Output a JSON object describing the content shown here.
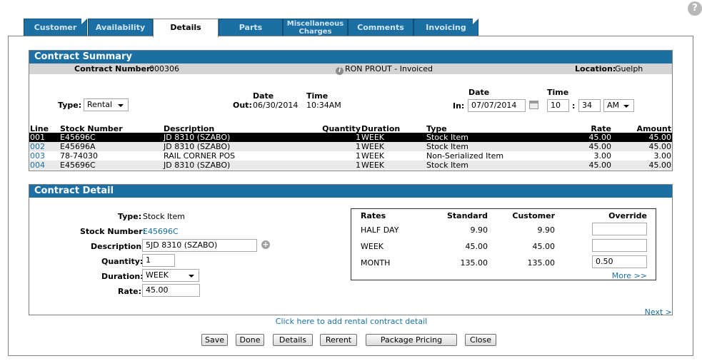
{
  "tabs": [
    {
      "label": "Customer"
    },
    {
      "label": "Availability"
    },
    {
      "label": "Details"
    },
    {
      "label": "Parts"
    },
    {
      "label": "Miscellaneous Charges",
      "line1": "Miscellaneous",
      "line2": "Charges"
    },
    {
      "label": "Comments"
    },
    {
      "label": "Invoicing"
    }
  ],
  "summary": {
    "title": "Contract Summary",
    "contract_label": "Contract Number:",
    "contract_number": "000306",
    "customer_status": "RON PROUT - Invoiced",
    "location_label": "Location:",
    "location": "Guelph",
    "type_label": "Type:",
    "type_value": "Rental",
    "out_label": "Out:",
    "date_header": "Date",
    "time_header": "Time",
    "out_date": "06/30/2014",
    "out_time": "10:34AM",
    "in_label": "In:",
    "in_date": "07/07/2014",
    "in_hour": "10",
    "time_sep": ":",
    "in_minute": "34",
    "in_ampm": "AM"
  },
  "table": {
    "headers": {
      "line": "Line",
      "stock": "Stock Number",
      "desc": "Description",
      "qty": "Quantity",
      "duration": "Duration",
      "type": "Type",
      "rate": "Rate",
      "amount": "Amount"
    },
    "rows": [
      {
        "line": "001",
        "stock": "E45696C",
        "desc": "JD 8310 (SZABO)",
        "qty": "1",
        "duration": "WEEK",
        "type": "Stock Item",
        "rate": "45.00",
        "amount": "45.00"
      },
      {
        "line": "002",
        "stock": "E45696A",
        "desc": "JD 8310 (SZABO)",
        "qty": "1",
        "duration": "WEEK",
        "type": "Stock Item",
        "rate": "45.00",
        "amount": "45.00"
      },
      {
        "line": "003",
        "stock": "78-74030",
        "desc": "RAIL CORNER POS",
        "qty": "1",
        "duration": "WEEK",
        "type": "Non-Serialized Item",
        "rate": "3.00",
        "amount": "3.00"
      },
      {
        "line": "004",
        "stock": "E45696C",
        "desc": "JD 8310 (SZABO)",
        "qty": "1",
        "duration": "WEEK",
        "type": "Stock Item",
        "rate": "45.00",
        "amount": "45.00"
      }
    ]
  },
  "detail": {
    "title": "Contract Detail",
    "type_label": "Type:",
    "type_value": "Stock Item",
    "stock_label": "Stock Number:",
    "stock_value": "E45696C",
    "desc_label": "Description:",
    "desc_value": "5JD 8310 (SZABO)",
    "qty_label": "Quantity:",
    "qty_value": "1",
    "duration_label": "Duration:",
    "duration_value": "WEEK",
    "rate_label": "Rate:",
    "rate_value": "45.00",
    "rates": {
      "headers": {
        "rates": "Rates",
        "standard": "Standard",
        "customer": "Customer",
        "override": "Override"
      },
      "rows": [
        {
          "name": "HALF DAY",
          "standard": "9.90",
          "customer": "9.90",
          "override": ""
        },
        {
          "name": "WEEK",
          "standard": "45.00",
          "customer": "45.00",
          "override": ""
        },
        {
          "name": "MONTH",
          "standard": "135.00",
          "customer": "135.00",
          "override": "0.50"
        }
      ],
      "more": "More >>"
    },
    "next": "Next >"
  },
  "add_link": "Click here to add rental contract detail",
  "buttons": {
    "save": "Save",
    "done": "Done",
    "details": "Details",
    "rerent": "Rerent",
    "package": "Package Pricing",
    "close": "Close"
  },
  "icons": {
    "help": "?",
    "plus": "+",
    "info": "i"
  }
}
